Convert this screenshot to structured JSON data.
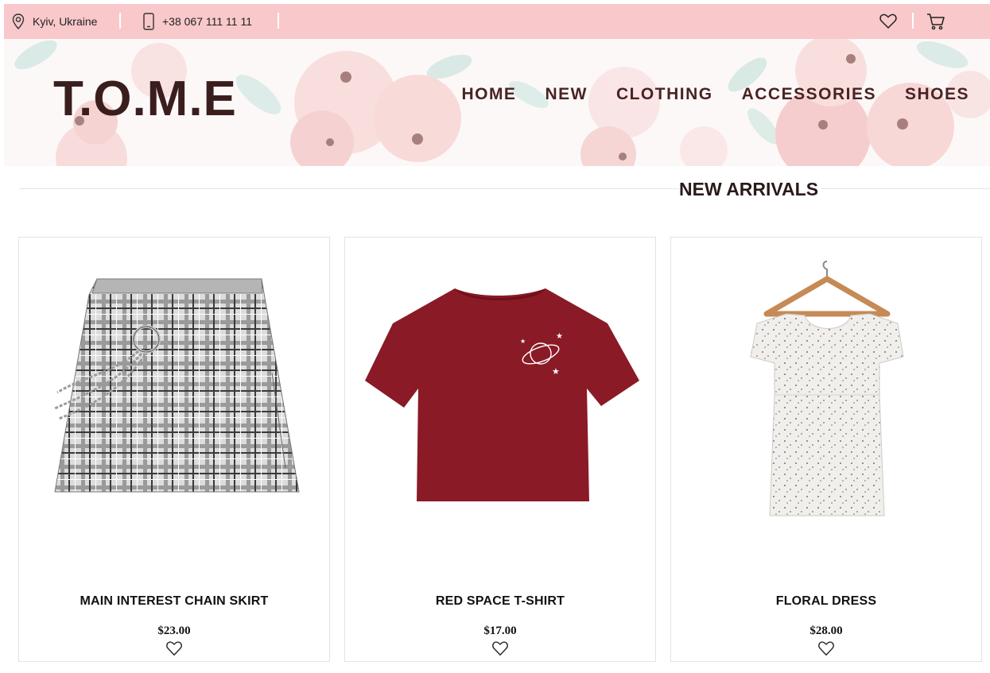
{
  "topbar": {
    "location": "Kyiv, Ukraine",
    "phone": "+38 067 111 11 11",
    "location_icon": "map-pin-icon",
    "phone_icon": "smartphone-icon",
    "wishlist_icon": "heart-icon",
    "cart_icon": "shopping-cart-icon",
    "background": "#f8c8cb"
  },
  "header": {
    "logo": "T.O.M.E",
    "nav": [
      "HOME",
      "NEW",
      "CLOTHING",
      "ACCESSORIES",
      "SHOES"
    ],
    "text_color": "#4a2323"
  },
  "section": {
    "title": "NEW ARRIVALS"
  },
  "products": [
    {
      "name": "MAIN INTEREST CHAIN SKIRT",
      "price": "$23.00",
      "image": "plaid-skirt-with-chain",
      "fav_icon": "heart-outline-icon"
    },
    {
      "name": "RED SPACE T-SHIRT",
      "price": "$17.00",
      "image": "red-tshirt-with-planet",
      "fav_icon": "heart-outline-icon"
    },
    {
      "name": "FLORAL DRESS",
      "price": "$28.00",
      "image": "floral-dress-on-hanger",
      "fav_icon": "heart-outline-icon"
    }
  ]
}
